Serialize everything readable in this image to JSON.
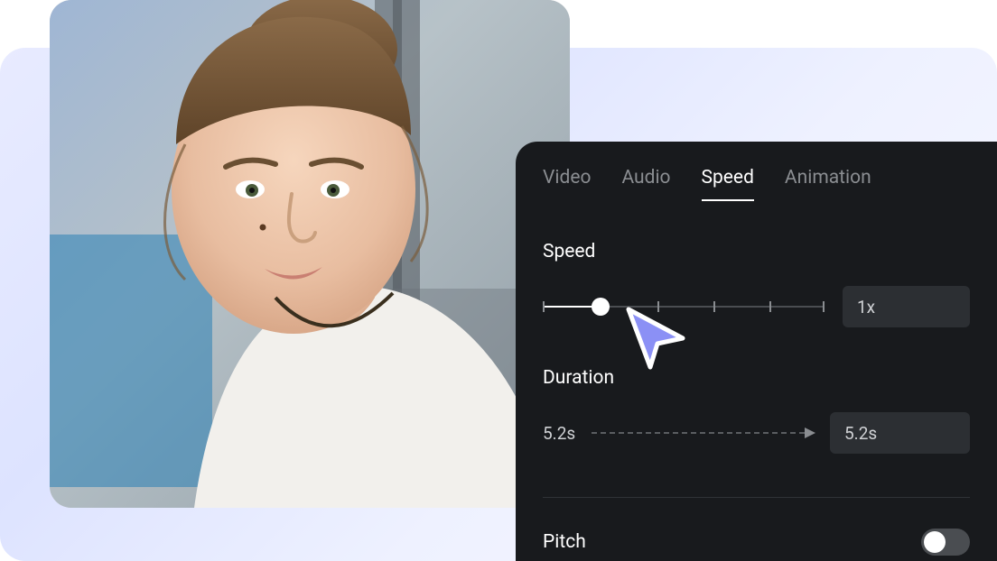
{
  "tabs": {
    "items": [
      {
        "label": "Video",
        "active": false
      },
      {
        "label": "Audio",
        "active": false
      },
      {
        "label": "Speed",
        "active": true
      },
      {
        "label": "Animation",
        "active": false
      }
    ]
  },
  "speed": {
    "label": "Speed",
    "value_display": "1x",
    "slider_fraction": 0.205,
    "ticks": [
      0,
      0.205,
      0.41,
      0.61,
      0.81,
      1.0
    ]
  },
  "duration": {
    "label": "Duration",
    "current": "5.2s",
    "target": "5.2s"
  },
  "pitch": {
    "label": "Pitch",
    "enabled": false
  }
}
